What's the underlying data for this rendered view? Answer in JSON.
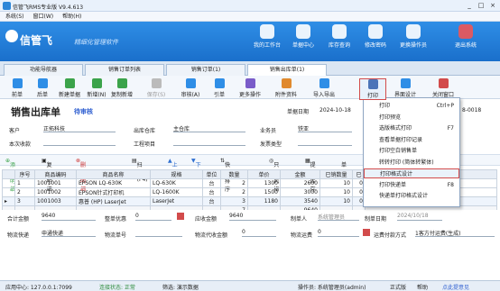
{
  "window": {
    "title": "信管飞RMS专业版 V9.4.613",
    "controls": [
      "_",
      "□",
      "×"
    ]
  },
  "menu": [
    "系统(S)",
    "窗口(W)",
    "帮助(H)"
  ],
  "banner": {
    "brand": "信管飞",
    "sub": "精细化管理软件",
    "nav": [
      "我的工作台",
      "单据中心",
      "库存查询",
      "修改密码",
      "更换操作员",
      "退出系统"
    ]
  },
  "tabs": [
    "功能导航器",
    "销售订单列表",
    "销售订单(1)",
    "销售出库单(1)"
  ],
  "toolbar": [
    {
      "label": "前单",
      "icon": "arrow-left-icon",
      "color": "#2f8ee6"
    },
    {
      "label": "后单",
      "icon": "arrow-right-icon",
      "color": "#2f8ee6"
    },
    {
      "label": "新建单据",
      "icon": "new-doc-icon",
      "color": "#3ba34a"
    },
    {
      "label": "新增(N)",
      "icon": "add-icon",
      "color": "#3ba34a"
    },
    {
      "label": "复制新增",
      "icon": "copy-icon",
      "color": "#3ba34a"
    },
    {
      "label": "保存(S)",
      "icon": "save-icon",
      "color": "#bbbbbb"
    },
    {
      "label": "审核(A)",
      "icon": "approve-icon",
      "color": "#2f8ee6"
    },
    {
      "label": "引单",
      "icon": "import-doc-icon",
      "color": "#2f8ee6"
    },
    {
      "label": "更多操作",
      "icon": "more-icon",
      "color": "#7a5cc9"
    },
    {
      "label": "附件资料",
      "icon": "attachment-icon",
      "color": "#e08a2e"
    },
    {
      "label": "导入导出",
      "icon": "import-export-icon",
      "color": "#2f8ee6"
    },
    {
      "label": "打印",
      "icon": "printer-icon",
      "color": "#4b74b8"
    },
    {
      "label": "界面设计",
      "icon": "layout-design-icon",
      "color": "#2f8ee6"
    },
    {
      "label": "关闭窗口",
      "icon": "close-window-icon",
      "color": "#d24b4b"
    }
  ],
  "doc": {
    "title": "销售出库单",
    "status": "待审核",
    "date_label": "单据日期",
    "date_value": "2024-10-18",
    "number_suffix": "8-0018",
    "labels": {
      "customer": "客户",
      "warehouse": "出库仓库",
      "salesman": "业务员",
      "collect": "本次收款",
      "project": "工程项目",
      "invoice": "发票类型"
    },
    "values": {
      "customer": "正拓科技",
      "warehouse": "主仓库",
      "salesman": "铁亚"
    }
  },
  "grid_toolbar": [
    "添加明细",
    "复制明细",
    "删除明细",
    "扫码(F4)",
    "上移",
    "下移",
    "快速排序",
    "只码风格",
    "提货库存",
    "单位"
  ],
  "table": {
    "headers": [
      "序号",
      "商品编码",
      "商品名称",
      "规格",
      "单位",
      "数量",
      "单价",
      "金额",
      "已销数量",
      "已",
      "备注"
    ],
    "rows": [
      [
        "1",
        "1001001",
        "EPSON LQ-630K",
        "LQ-630K",
        "台",
        "2",
        "1300",
        "2600",
        "10",
        "0",
        ""
      ],
      [
        "2",
        "1001002",
        "EPSON针式打印机",
        "LQ-1600K",
        "台",
        "2",
        "1500",
        "3000",
        "10",
        "0",
        ""
      ],
      [
        "3",
        "1001003",
        "惠普 (HP) LaserJet",
        "LaserJet",
        "台",
        "3",
        "1180",
        "3540",
        "10",
        "0",
        ""
      ]
    ],
    "totals": {
      "qty": "7",
      "amount": "9640"
    }
  },
  "footer": {
    "labels": {
      "total": "合计金额",
      "discount": "整单优惠",
      "receivable": "应收金额",
      "creator": "制单人",
      "create_date": "制单日期",
      "logistics": "物流快递",
      "logistics_no": "物流单号",
      "freight": "物流代收金额",
      "freight_fee": "物流运费",
      "paid_by": "运费付款方式"
    },
    "values": {
      "total": "9640",
      "discount": "0",
      "receivable": "9640",
      "creator": "系统管理员",
      "create_date": "2024/10/18",
      "logistics": "申通快递",
      "freight": "0",
      "freight_fee": "0",
      "paid_by": "1客方付运费(生成)"
    }
  },
  "status": {
    "app": "应用中心: 127.0.0.1:7099",
    "conn": "连接状态: 正常",
    "filter": "筛选: 演示数据",
    "operator": "操作员: 系统管理员(admin)",
    "mode": "正式版",
    "help": "帮助",
    "feedback": "点此提意见"
  },
  "print_menu": [
    {
      "label": "打印",
      "shortcut": "Ctrl+P"
    },
    {
      "label": "打印预览",
      "shortcut": ""
    },
    {
      "label": "选版格式打印",
      "shortcut": "F7"
    },
    {
      "label": "查看单据打印记录",
      "shortcut": ""
    },
    {
      "label": "打印空白销售单",
      "shortcut": ""
    },
    {
      "label": "转转打印 (简体转繁体)",
      "shortcut": ""
    },
    {
      "label": "打印格式设计",
      "shortcut": ""
    },
    {
      "label": "打印快递单",
      "shortcut": "F8"
    },
    {
      "label": "快递单打印格式设计",
      "shortcut": ""
    }
  ]
}
